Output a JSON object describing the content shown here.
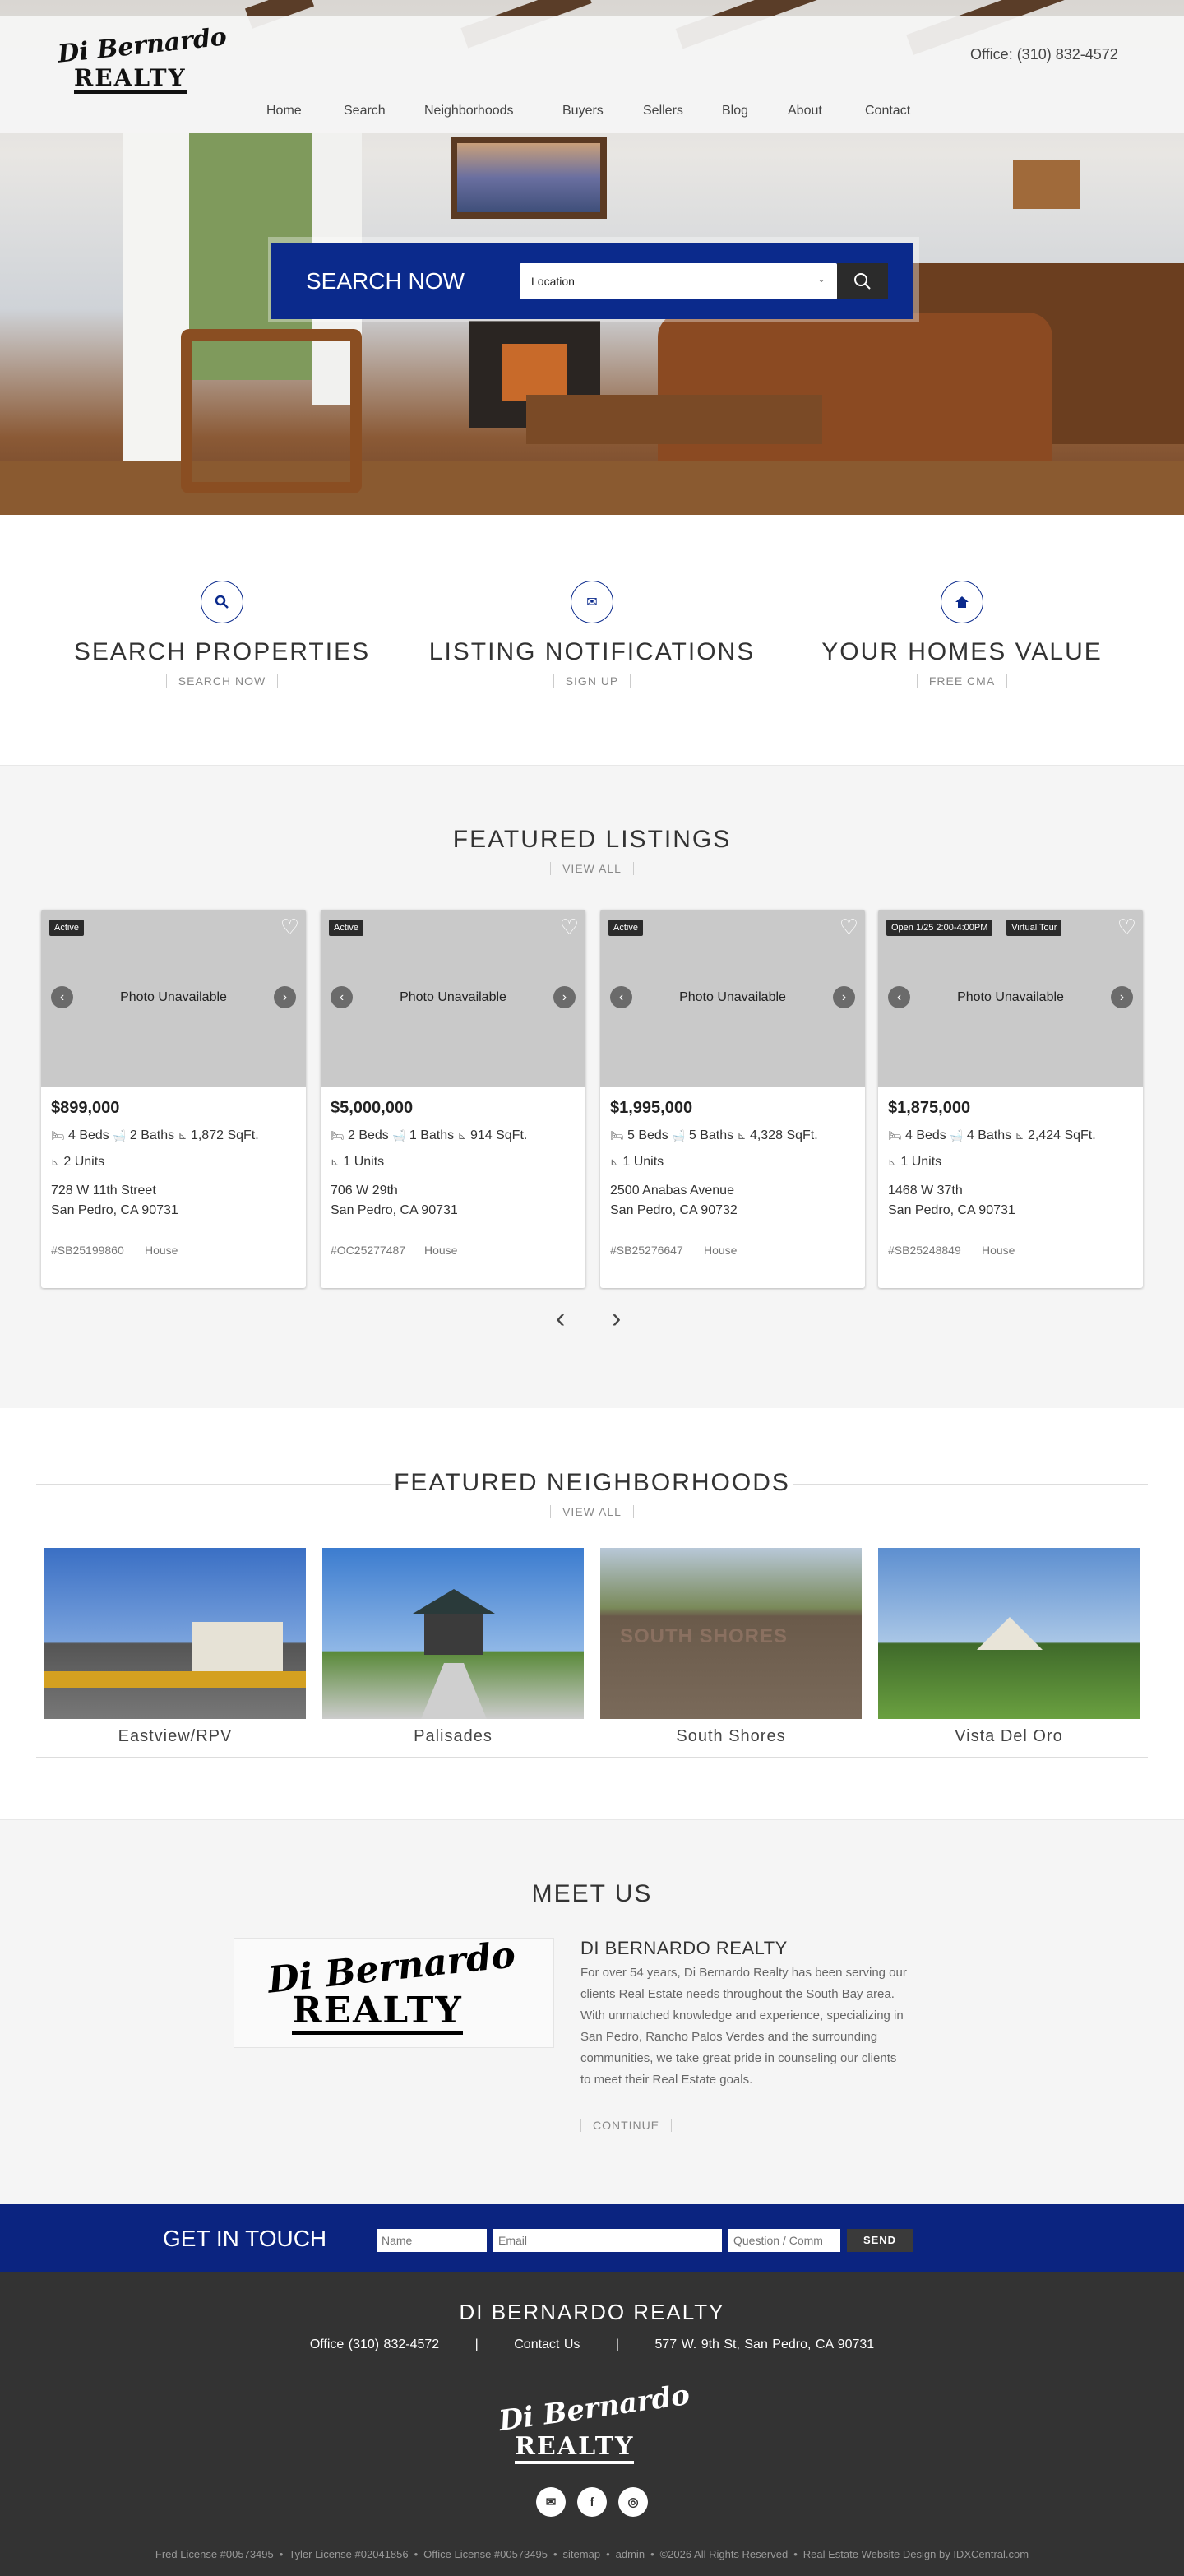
{
  "header": {
    "logo_script": "Di Bernardo",
    "logo_block": "REALTY",
    "office": "Office: (310) 832-4572",
    "nav": [
      "Home",
      "Search",
      "Neighborhoods",
      "Buyers",
      "Sellers",
      "Blog",
      "About",
      "Contact"
    ]
  },
  "hero_search": {
    "title": "SEARCH NOW",
    "location_value": "Location",
    "search_icon": "search-icon"
  },
  "services": [
    {
      "icon": "search-icon",
      "title": "SEARCH PROPERTIES",
      "link": "SEARCH NOW"
    },
    {
      "icon": "envelope-icon",
      "title": "LISTING NOTIFICATIONS",
      "link": "SIGN UP"
    },
    {
      "icon": "home-icon",
      "title": "YOUR HOMES VALUE",
      "link": "FREE CMA"
    }
  ],
  "featured_listings": {
    "title": "FEATURED LISTINGS",
    "view_all": "VIEW ALL",
    "photo_text": "Photo Unavailable",
    "listings": [
      {
        "badges": [
          "Active"
        ],
        "price": "$899,000",
        "beds": "4 Beds",
        "baths": "2 Baths",
        "sqft": "1,872 SqFt.",
        "units": "2 Units",
        "street": "728 W 11th Street",
        "city": "San Pedro, CA 90731",
        "mls": "#SB25199860",
        "type": "House"
      },
      {
        "badges": [
          "Active"
        ],
        "price": "$5,000,000",
        "beds": "2 Beds",
        "baths": "1 Baths",
        "sqft": "914 SqFt.",
        "units": "1 Units",
        "street": "706 W 29th",
        "city": "San Pedro, CA 90731",
        "mls": "#OC25277487",
        "type": "House"
      },
      {
        "badges": [
          "Active"
        ],
        "price": "$1,995,000",
        "beds": "5 Beds",
        "baths": "5 Baths",
        "sqft": "4,328 SqFt.",
        "units": "1 Units",
        "street": "2500 Anabas Avenue",
        "city": "San Pedro, CA 90732",
        "mls": "#SB25276647",
        "type": "House"
      },
      {
        "badges": [
          "Open 1/25 2:00-4:00PM",
          "Virtual Tour"
        ],
        "price": "$1,875,000",
        "beds": "4 Beds",
        "baths": "4 Baths",
        "sqft": "2,424 SqFt.",
        "units": "1 Units",
        "street": "1468 W 37th",
        "city": "San Pedro, CA 90731",
        "mls": "#SB25248849",
        "type": "House"
      }
    ]
  },
  "neighborhoods": {
    "title": "FEATURED NEIGHBORHOODS",
    "view_all": "VIEW ALL",
    "items": [
      "Eastview/RPV",
      "Palisades",
      "South Shores",
      "Vista Del Oro"
    ],
    "sign_text": "SOUTH SHORES"
  },
  "meet_us": {
    "title": "MEET US",
    "heading": "DI BERNARDO REALTY",
    "lines": [
      "For over 54 years, Di Bernardo Realty has been serving our",
      "clients Real Estate needs throughout the South Bay area.",
      "With unmatched knowledge and experience, specializing in",
      "San Pedro, Rancho Palos Verdes and the surrounding",
      "communities, we take great pride in counseling our clients",
      "to meet their Real Estate goals."
    ],
    "continue": "CONTINUE"
  },
  "get_in_touch": {
    "title": "GET IN TOUCH",
    "name_placeholder": "Name",
    "email_placeholder": "Email",
    "question_placeholder": "Question / Comm",
    "send": "SEND"
  },
  "footer": {
    "title": "DI BERNARDO REALTY",
    "office": "Office (310) 832-4572",
    "contact": "Contact Us",
    "address": "577 W. 9th St, San Pedro, CA 90731",
    "sep": "|",
    "legal": [
      "Fred License #00573495",
      "Tyler License #02041856",
      "Office License #00573495",
      "sitemap",
      "admin",
      "©2026 All Rights Reserved",
      "Real Estate Website Design by IDXCentral.com"
    ],
    "dot": "•"
  },
  "colors": {
    "brand_blue": "#0b2a8c",
    "footer_bg": "#333333"
  }
}
